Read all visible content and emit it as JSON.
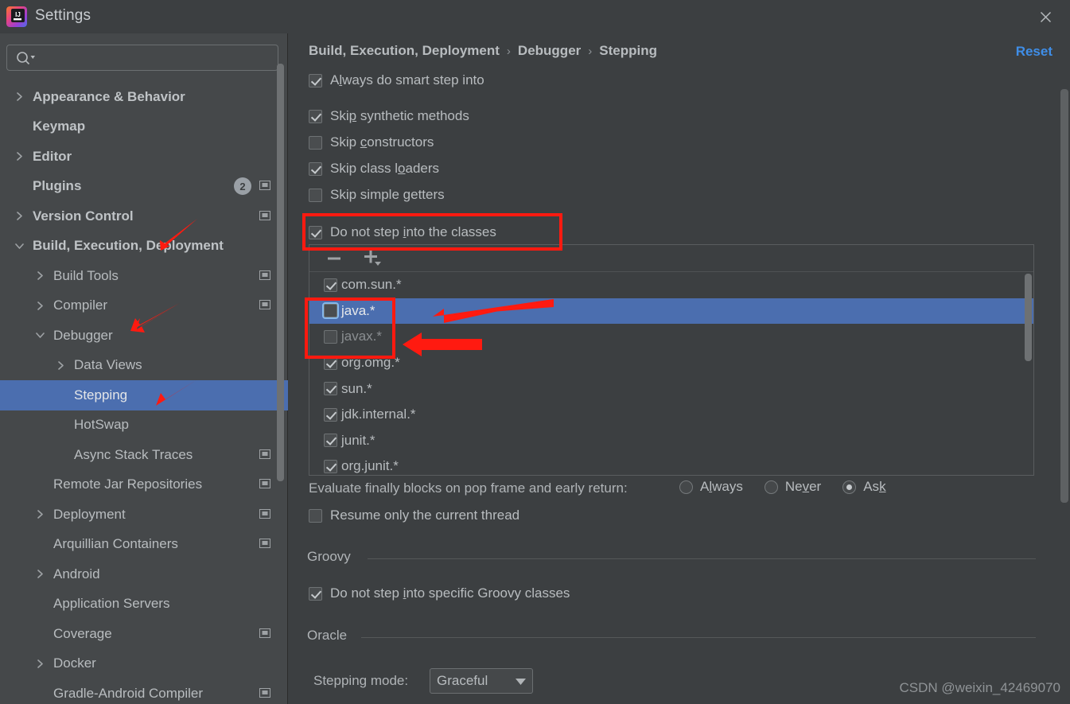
{
  "window": {
    "title": "Settings",
    "logo_icon": "intellij-idea-logo",
    "close_icon": "close-icon"
  },
  "sidebar": {
    "search": {
      "value": "",
      "placeholder": "",
      "icon": "search-icon",
      "dropdown_icon": "chevron-down-icon"
    },
    "items": [
      {
        "label": "Appearance & Behavior",
        "indent": 0,
        "twisty": "collapsed",
        "bold": true,
        "selected": false,
        "badge": "",
        "scope_icon": false
      },
      {
        "label": "Keymap",
        "indent": 0,
        "twisty": "none",
        "bold": true,
        "selected": false,
        "badge": "",
        "scope_icon": false
      },
      {
        "label": "Editor",
        "indent": 0,
        "twisty": "collapsed",
        "bold": true,
        "selected": false,
        "badge": "",
        "scope_icon": false
      },
      {
        "label": "Plugins",
        "indent": 0,
        "twisty": "none",
        "bold": true,
        "selected": false,
        "badge": "2",
        "scope_icon": true
      },
      {
        "label": "Version Control",
        "indent": 0,
        "twisty": "collapsed",
        "bold": true,
        "selected": false,
        "badge": "",
        "scope_icon": true
      },
      {
        "label": "Build, Execution, Deployment",
        "indent": 0,
        "twisty": "expanded",
        "bold": true,
        "selected": false,
        "badge": "",
        "scope_icon": false
      },
      {
        "label": "Build Tools",
        "indent": 1,
        "twisty": "collapsed",
        "bold": false,
        "selected": false,
        "badge": "",
        "scope_icon": true
      },
      {
        "label": "Compiler",
        "indent": 1,
        "twisty": "collapsed",
        "bold": false,
        "selected": false,
        "badge": "",
        "scope_icon": true
      },
      {
        "label": "Debugger",
        "indent": 1,
        "twisty": "expanded",
        "bold": false,
        "selected": false,
        "badge": "",
        "scope_icon": false
      },
      {
        "label": "Data Views",
        "indent": 2,
        "twisty": "collapsed",
        "bold": false,
        "selected": false,
        "badge": "",
        "scope_icon": false
      },
      {
        "label": "Stepping",
        "indent": 2,
        "twisty": "none",
        "bold": false,
        "selected": true,
        "badge": "",
        "scope_icon": false
      },
      {
        "label": "HotSwap",
        "indent": 2,
        "twisty": "none",
        "bold": false,
        "selected": false,
        "badge": "",
        "scope_icon": false
      },
      {
        "label": "Async Stack Traces",
        "indent": 2,
        "twisty": "none",
        "bold": false,
        "selected": false,
        "badge": "",
        "scope_icon": true
      },
      {
        "label": "Remote Jar Repositories",
        "indent": 1,
        "twisty": "none",
        "bold": false,
        "selected": false,
        "badge": "",
        "scope_icon": true
      },
      {
        "label": "Deployment",
        "indent": 1,
        "twisty": "collapsed",
        "bold": false,
        "selected": false,
        "badge": "",
        "scope_icon": true
      },
      {
        "label": "Arquillian Containers",
        "indent": 1,
        "twisty": "none",
        "bold": false,
        "selected": false,
        "badge": "",
        "scope_icon": true
      },
      {
        "label": "Android",
        "indent": 1,
        "twisty": "collapsed",
        "bold": false,
        "selected": false,
        "badge": "",
        "scope_icon": false
      },
      {
        "label": "Application Servers",
        "indent": 1,
        "twisty": "none",
        "bold": false,
        "selected": false,
        "badge": "",
        "scope_icon": false
      },
      {
        "label": "Coverage",
        "indent": 1,
        "twisty": "none",
        "bold": false,
        "selected": false,
        "badge": "",
        "scope_icon": true
      },
      {
        "label": "Docker",
        "indent": 1,
        "twisty": "collapsed",
        "bold": false,
        "selected": false,
        "badge": "",
        "scope_icon": false
      },
      {
        "label": "Gradle-Android Compiler",
        "indent": 1,
        "twisty": "none",
        "bold": false,
        "selected": false,
        "badge": "",
        "scope_icon": true
      }
    ]
  },
  "main": {
    "breadcrumb": {
      "part1": "Build, Execution, Deployment",
      "part2": "Debugger",
      "part3": "Stepping",
      "separator": "›"
    },
    "reset_label": "Reset",
    "options": [
      {
        "label_pre": "A",
        "label_mn": "l",
        "label_post": "ways do smart step into",
        "checked": true
      },
      {
        "label_pre": "Ski",
        "label_mn": "p",
        "label_post": " synthetic methods",
        "checked": true
      },
      {
        "label_pre": "Skip ",
        "label_mn": "c",
        "label_post": "onstructors",
        "checked": false
      },
      {
        "label_pre": "Skip class l",
        "label_mn": "o",
        "label_post": "aders",
        "checked": true
      },
      {
        "label_pre": "Skip simple ",
        "label_mn": "g",
        "label_post": "etters",
        "checked": false
      }
    ],
    "do_not_step": {
      "label_pre": "Do not step ",
      "label_mn": "i",
      "label_post": "nto the classes",
      "checked": true
    },
    "list_toolbar": {
      "remove_icon": "minus-icon",
      "add_icon": "plus-icon",
      "add_dropdown_icon": "chevron-down-icon"
    },
    "class_list": [
      {
        "pattern": "com.sun.*",
        "checked": true,
        "selected": false,
        "dim": false,
        "focus": false
      },
      {
        "pattern": "java.*",
        "checked": false,
        "selected": true,
        "dim": false,
        "focus": true
      },
      {
        "pattern": "javax.*",
        "checked": false,
        "selected": false,
        "dim": true,
        "focus": false
      },
      {
        "pattern": "org.omg.*",
        "checked": true,
        "selected": false,
        "dim": false,
        "focus": false
      },
      {
        "pattern": "sun.*",
        "checked": true,
        "selected": false,
        "dim": false,
        "focus": false
      },
      {
        "pattern": "jdk.internal.*",
        "checked": true,
        "selected": false,
        "dim": false,
        "focus": false
      },
      {
        "pattern": "junit.*",
        "checked": true,
        "selected": false,
        "dim": false,
        "focus": false
      },
      {
        "pattern": "org.junit.*",
        "checked": true,
        "selected": false,
        "dim": false,
        "focus": false
      }
    ],
    "evaluate_finally": {
      "label": "Evaluate finally blocks on pop frame and early return:",
      "options": [
        {
          "pre": "A",
          "mn": "l",
          "post": "ways",
          "selected": false
        },
        {
          "pre": "Ne",
          "mn": "v",
          "post": "er",
          "selected": false
        },
        {
          "pre": "As",
          "mn": "k",
          "post": "",
          "selected": true
        }
      ]
    },
    "resume_only": {
      "label": "Resume only the current thread",
      "checked": false
    },
    "groovy": {
      "section": "Groovy",
      "option": {
        "label_pre": "Do not step ",
        "label_mn": "i",
        "label_post": "nto specific Groovy classes",
        "checked": true
      }
    },
    "oracle": {
      "section": "Oracle",
      "stepping_mode_label": "Stepping mode:",
      "stepping_mode_value": "Graceful",
      "dropdown_icon": "triangle-down-icon"
    }
  },
  "watermark": "CSDN @weixin_42469070",
  "colors": {
    "accent_blue": "#4b6eaf",
    "link_blue": "#3f8ee8",
    "annotation_red": "#ff1a10",
    "bg": "#3c3f41",
    "sidebar_bg": "#45484a"
  }
}
